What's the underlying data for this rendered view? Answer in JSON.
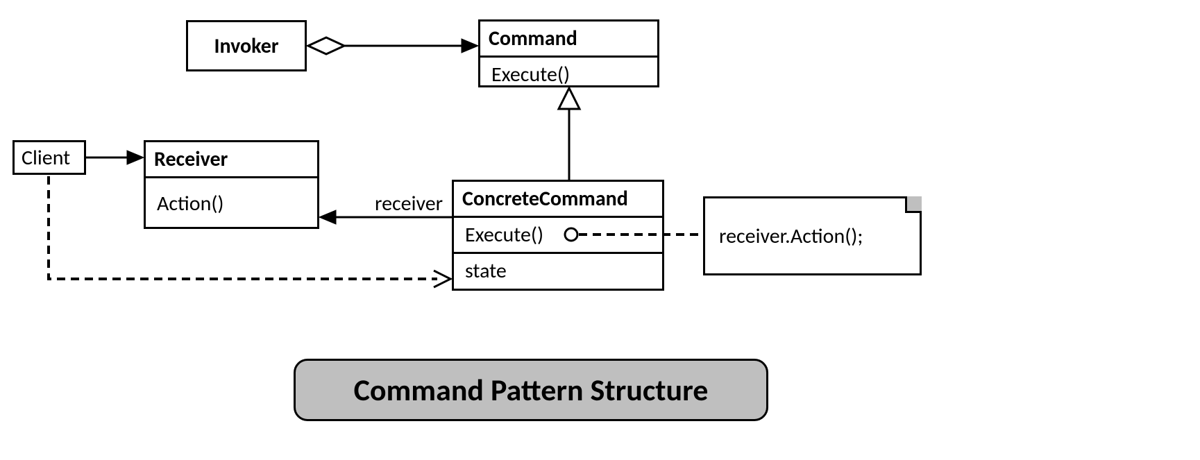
{
  "diagram": {
    "title": "Command Pattern Structure",
    "client": {
      "label": "Client"
    },
    "invoker": {
      "label": "Invoker"
    },
    "receiver": {
      "label": "Receiver",
      "method": "Action()"
    },
    "command": {
      "label": "Command",
      "method": "Execute()"
    },
    "concrete_command": {
      "label": "ConcreteCommand",
      "method": "Execute()",
      "state_label": "state"
    },
    "note": {
      "text": "receiver.Action();"
    },
    "labels": {
      "receiver_role": "receiver"
    }
  }
}
